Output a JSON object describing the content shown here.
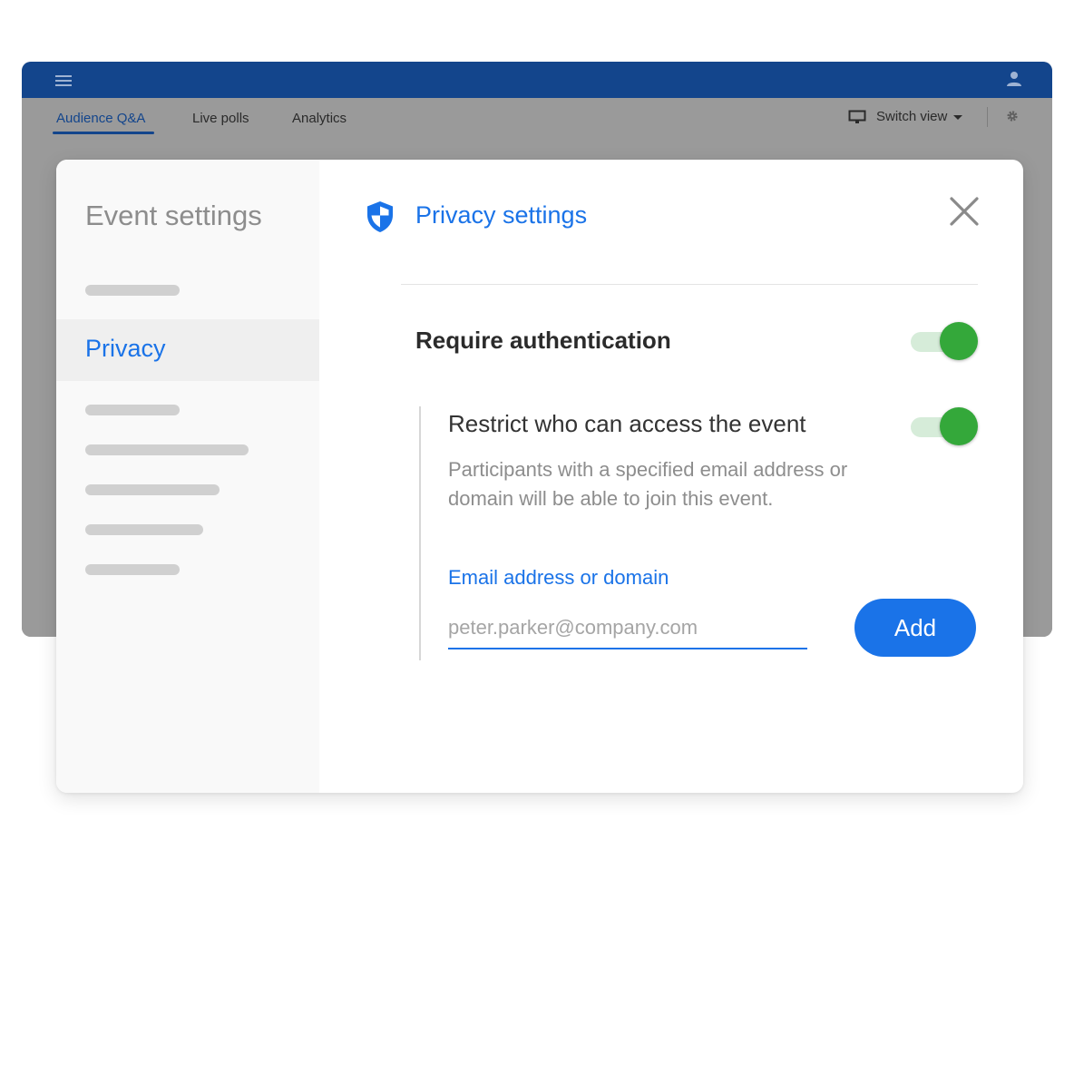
{
  "app": {
    "tabs": [
      {
        "label": "Audience Q&A",
        "active": true
      },
      {
        "label": "Live polls",
        "active": false
      },
      {
        "label": "Analytics",
        "active": false
      }
    ],
    "switch_view_label": "Switch view",
    "icons": {
      "menu": "hamburger-menu-icon",
      "user": "user-icon",
      "monitor": "monitor-icon",
      "caret": "caret-down-icon",
      "gear": "gear-icon"
    }
  },
  "modal": {
    "sidebar": {
      "title": "Event settings",
      "active_item": "Privacy"
    },
    "main": {
      "title": "Privacy settings",
      "require_auth": {
        "label": "Require authentication",
        "enabled": true
      },
      "restrict": {
        "label": "Restrict who can access the event",
        "enabled": true,
        "description": "Participants with a specified email address or domain will be able to join this event."
      },
      "email_field": {
        "label": "Email address or domain",
        "placeholder": "peter.parker@company.com",
        "value": ""
      },
      "add_button": "Add",
      "icons": {
        "shield": "shield-icon",
        "close": "close-icon"
      }
    }
  },
  "colors": {
    "brand": "#13458c",
    "accent": "#1a73e8",
    "toggle_on": "#34a83a",
    "toggle_track": "#d6ecd9"
  }
}
